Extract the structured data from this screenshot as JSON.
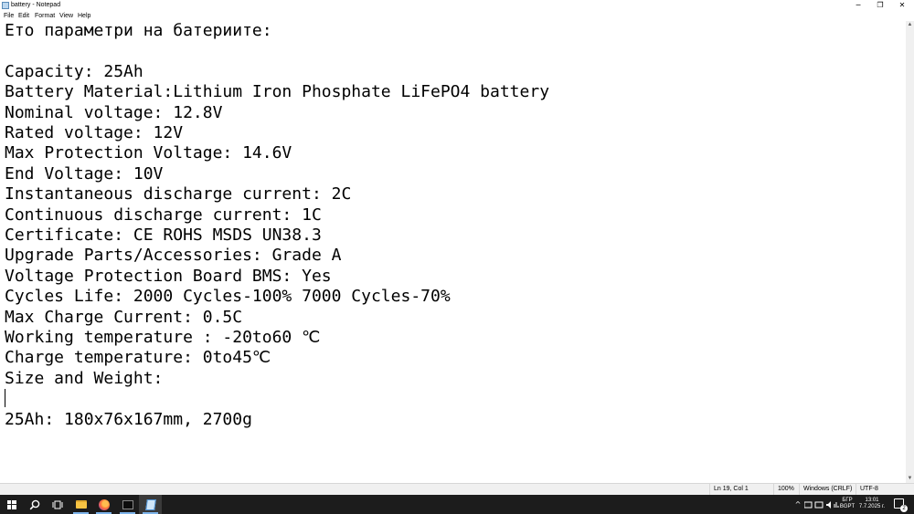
{
  "window": {
    "title": "battery - Notepad",
    "minimize_glyph": "─",
    "maximize_glyph": "❐",
    "close_glyph": "✕"
  },
  "menu": [
    "File",
    "Edit",
    "Format",
    "View",
    "Help"
  ],
  "document": {
    "lines": [
      "Ето параметри на батериите:",
      "",
      "Capacity: 25Ah",
      "Battery Material:Lithium Iron Phosphate LiFePO4 battery",
      "Nominal voltage: 12.8V",
      "Rated voltage: 12V",
      "Max Protection Voltage: 14.6V",
      "End Voltage: 10V",
      "Instantaneous discharge current: 2C",
      "Continuous discharge current: 1C",
      "Certificate: CE ROHS MSDS UN38.3",
      "Upgrade Parts/Accessories: Grade A",
      "Voltage Protection Board BMS: Yes",
      "Cycles Life: 2000 Cycles-100% 7000 Cycles-70%",
      "Max Charge Current: 0.5C",
      "Working temperature : -20to60 ℃",
      "Charge temperature: 0to45℃",
      "Size and Weight:",
      "",
      "25Ah: 180x76x167mm, 2700g"
    ]
  },
  "status": {
    "position": "Ln 19, Col 1",
    "zoom": "100%",
    "line_ending": "Windows (CRLF)",
    "encoding": "UTF-8"
  },
  "taskbar": {
    "apps": [
      "start",
      "search",
      "task-view",
      "file-explorer",
      "firefox",
      "terminal",
      "notepad"
    ],
    "tray": {
      "expand_glyph": "^",
      "language_top": "БГР",
      "language_bottom": "BGPT",
      "time": "13:01",
      "date": "7.7.2025 г.",
      "notification_count": "2"
    }
  }
}
